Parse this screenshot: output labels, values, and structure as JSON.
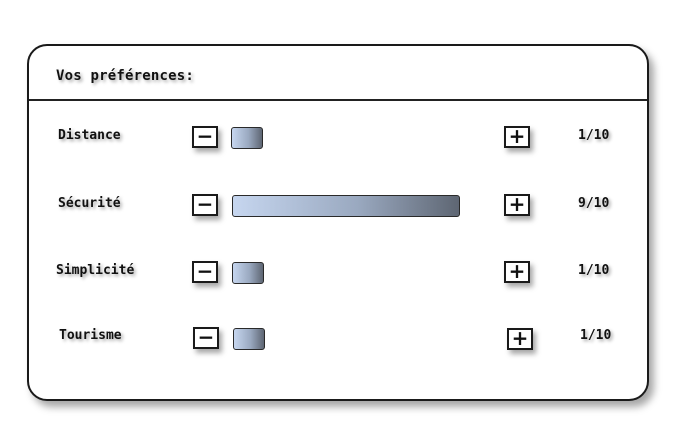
{
  "panel": {
    "title": "Vos préférences:"
  },
  "icons": {
    "minus": "minus-icon",
    "plus": "plus-icon"
  },
  "colors": {
    "bar_start": "#c6d6ef",
    "bar_end": "#5e6673",
    "border": "#1a1a1a"
  },
  "preferences": [
    {
      "label": "Distance",
      "minus_label": "−",
      "plus_label": "+",
      "score": "1/10",
      "level": 1,
      "max": 10
    },
    {
      "label": "Sécurité",
      "minus_label": "−",
      "plus_label": "+",
      "score": "9/10",
      "level": 9,
      "max": 10
    },
    {
      "label": "Simplicité",
      "minus_label": "−",
      "plus_label": "+",
      "score": "1/10",
      "level": 1,
      "max": 10
    },
    {
      "label": "Tourisme",
      "minus_label": "−",
      "plus_label": "+",
      "score": "1/10",
      "level": 1,
      "max": 10
    }
  ]
}
